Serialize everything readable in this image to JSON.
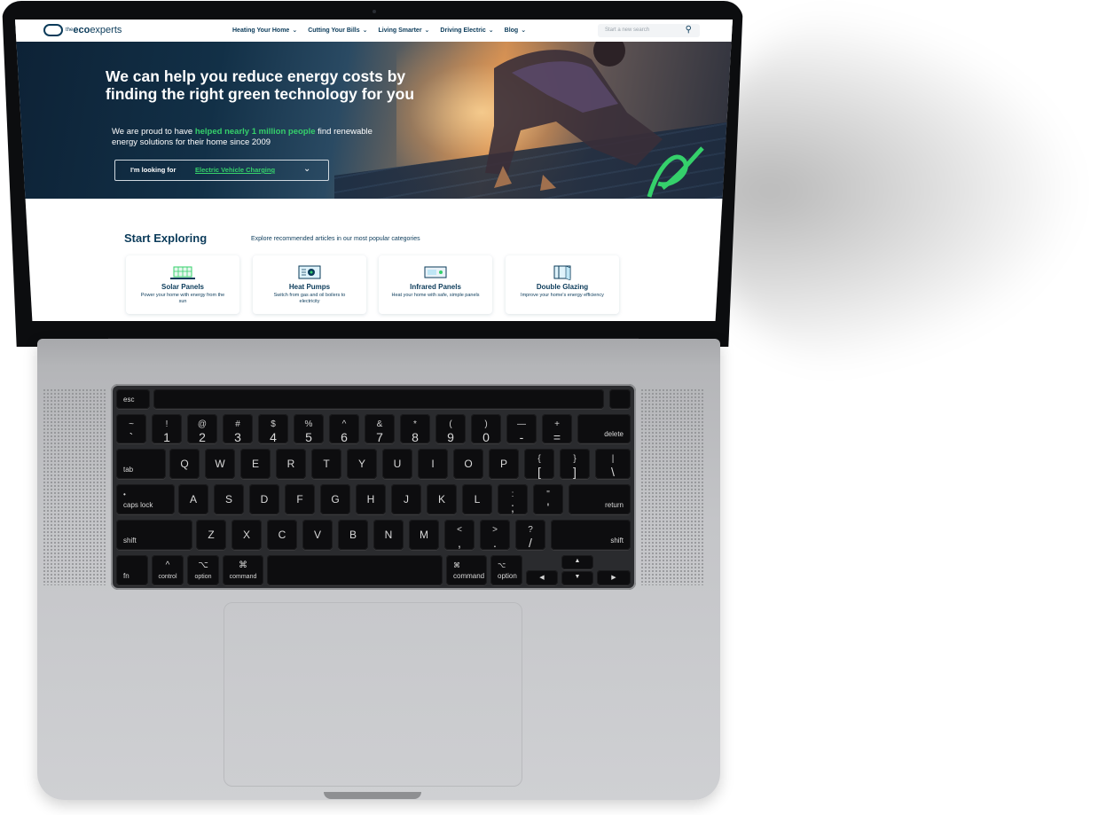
{
  "site": {
    "logo": {
      "the": "the",
      "eco": "eco",
      "experts": "experts"
    },
    "nav": [
      {
        "label": "Heating Your Home"
      },
      {
        "label": "Cutting Your Bills"
      },
      {
        "label": "Living Smarter"
      },
      {
        "label": "Driving Electric"
      },
      {
        "label": "Blog"
      }
    ],
    "search": {
      "placeholder": "Start a new search"
    },
    "hero": {
      "title": "We can help you reduce energy costs by finding the right green technology for you",
      "sub_pre": "We are proud to have ",
      "sub_highlight": "helped nearly 1 million people",
      "sub_post": " find renewable energy solutions for their home since 2009",
      "select_label": "I'm looking for",
      "select_value": "Electric Vehicle Charging"
    },
    "explore": {
      "title": "Start Exploring",
      "subtitle": "Explore recommended articles in our most popular categories",
      "cards": [
        {
          "title": "Solar Panels",
          "desc": "Power your home with energy from the sun",
          "icon": "solar-panel-icon"
        },
        {
          "title": "Heat Pumps",
          "desc": "Switch from gas and oil boilers to electricity",
          "icon": "heat-pump-icon"
        },
        {
          "title": "Infrared Panels",
          "desc": "Heat your home with safe, simple panels",
          "icon": "infrared-panel-icon"
        },
        {
          "title": "Double Glazing",
          "desc": "Improve your home's energy efficiency",
          "icon": "window-icon"
        }
      ]
    },
    "colors": {
      "navy": "#0b3b5a",
      "green": "#35d06b"
    }
  },
  "keyboard": {
    "esc": "esc",
    "numrow": [
      {
        "top": "~",
        "bottom": "`"
      },
      {
        "top": "!",
        "bottom": "1"
      },
      {
        "top": "@",
        "bottom": "2"
      },
      {
        "top": "#",
        "bottom": "3"
      },
      {
        "top": "$",
        "bottom": "4"
      },
      {
        "top": "%",
        "bottom": "5"
      },
      {
        "top": "^",
        "bottom": "6"
      },
      {
        "top": "&",
        "bottom": "7"
      },
      {
        "top": "*",
        "bottom": "8"
      },
      {
        "top": "(",
        "bottom": "9"
      },
      {
        "top": ")",
        "bottom": "0"
      },
      {
        "top": "—",
        "bottom": "-"
      },
      {
        "top": "+",
        "bottom": "="
      }
    ],
    "delete": "delete",
    "tab": "tab",
    "qrow": [
      "Q",
      "W",
      "E",
      "R",
      "T",
      "Y",
      "U",
      "I",
      "O",
      "P"
    ],
    "qrow_brackets": [
      {
        "top": "{",
        "bottom": "["
      },
      {
        "top": "}",
        "bottom": "]"
      },
      {
        "top": "|",
        "bottom": "\\"
      }
    ],
    "caps": "caps lock",
    "caps_dot": "•",
    "arow": [
      "A",
      "S",
      "D",
      "F",
      "G",
      "H",
      "J",
      "K",
      "L"
    ],
    "arow_punct": [
      {
        "top": ":",
        "bottom": ";"
      },
      {
        "top": "\"",
        "bottom": "'"
      }
    ],
    "return": "return",
    "shift": "shift",
    "zrow": [
      "Z",
      "X",
      "C",
      "V",
      "B",
      "N",
      "M"
    ],
    "zrow_punct": [
      {
        "top": "<",
        "bottom": ","
      },
      {
        "top": ">",
        "bottom": "."
      },
      {
        "top": "?",
        "bottom": "/"
      }
    ],
    "fn": "fn",
    "control": "control",
    "control_sym": "^",
    "option": "option",
    "option_sym": "⌥",
    "command": "command",
    "command_sym": "⌘",
    "arrows": {
      "up": "▲",
      "left": "◀",
      "down": "▼",
      "right": "▶"
    }
  }
}
